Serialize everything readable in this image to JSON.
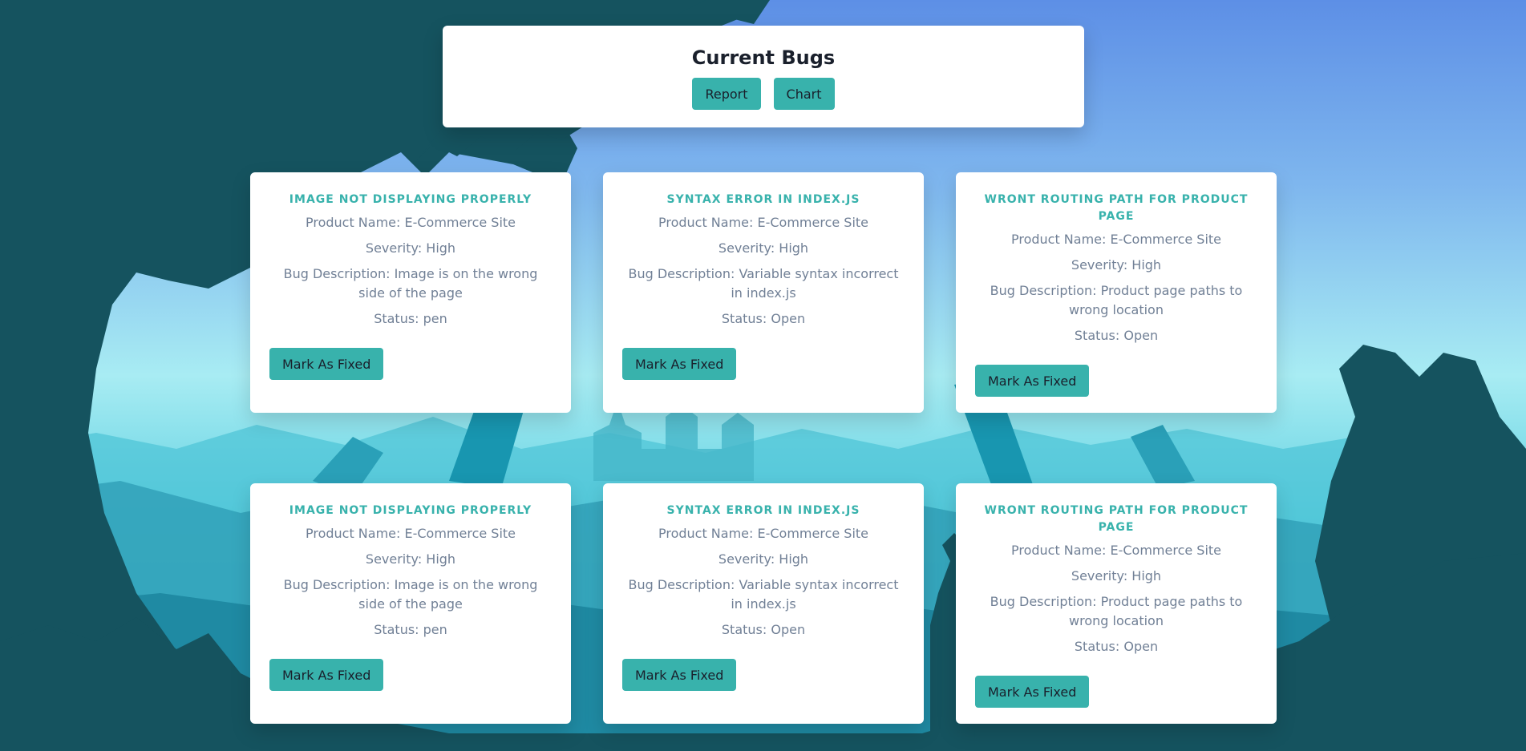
{
  "header": {
    "title": "Current Bugs",
    "report_label": "Report",
    "chart_label": "Chart"
  },
  "bugs": [
    {
      "title": "Image not displaying properly",
      "product": "Product Name: E-Commerce Site",
      "severity": "Severity: High",
      "description": "Bug Description: Image is on the wrong side of the page",
      "status": "Status: pen",
      "button": "Mark As Fixed"
    },
    {
      "title": "Syntax error in index.js",
      "product": "Product Name: E-Commerce Site",
      "severity": "Severity: High",
      "description": "Bug Description: Variable syntax incorrect in index.js",
      "status": "Status: Open",
      "button": "Mark As Fixed"
    },
    {
      "title": "Wront routing path for product page",
      "product": "Product Name: E-Commerce Site",
      "severity": "Severity: High",
      "description": "Bug Description: Product page paths to wrong location",
      "status": "Status: Open",
      "button": "Mark As Fixed"
    },
    {
      "title": "Image not displaying properly",
      "product": "Product Name: E-Commerce Site",
      "severity": "Severity: High",
      "description": "Bug Description: Image is on the wrong side of the page",
      "status": "Status: pen",
      "button": "Mark As Fixed"
    },
    {
      "title": "Syntax error in index.js",
      "product": "Product Name: E-Commerce Site",
      "severity": "Severity: High",
      "description": "Bug Description: Variable syntax incorrect in index.js",
      "status": "Status: Open",
      "button": "Mark As Fixed"
    },
    {
      "title": "Wront routing path for product page",
      "product": "Product Name: E-Commerce Site",
      "severity": "Severity: High",
      "description": "Bug Description: Product page paths to wrong location",
      "status": "Status: Open",
      "button": "Mark As Fixed"
    }
  ],
  "colors": {
    "accent": "#38b2ac",
    "sky_top": "#5d8fe6",
    "silhouette": "#15535f"
  }
}
